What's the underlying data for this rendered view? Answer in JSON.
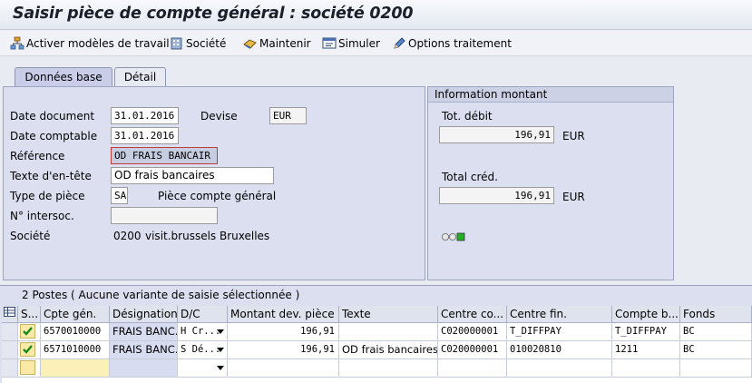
{
  "window": {
    "title": "Saisir pièce de compte général : société 0200"
  },
  "toolbar": {
    "activate_label": "Activer modèles de travail",
    "company_label": "Société",
    "hold_label": "Maintenir",
    "simulate_label": "Simuler",
    "options_label": "Options traitement"
  },
  "tabs": [
    {
      "label": "Données base"
    },
    {
      "label": "Détail"
    }
  ],
  "form": {
    "doc_date_label": "Date document",
    "doc_date": "31.01.2016",
    "currency_label": "Devise",
    "currency": "EUR",
    "post_date_label": "Date comptable",
    "post_date": "31.01.2016",
    "reference_label": "Référence",
    "reference": "OD FRAIS BANCAIR",
    "header_text_label": "Texte d'en-tête",
    "header_text": "OD frais bancaires",
    "doc_type_label": "Type de pièce",
    "doc_type": "SA",
    "doc_type_desc": "Pièce compte général",
    "intercomp_label": "N° intersoc.",
    "intercomp": "",
    "company_label": "Société",
    "company": "0200",
    "company_name": "visit.brussels Bruxelles"
  },
  "amount_info": {
    "header": "Information montant",
    "total_debit_label": "Tot. débit",
    "total_debit": "196,91",
    "total_debit_cur": "EUR",
    "total_credit_label": "Total créd.",
    "total_credit": "196,91",
    "total_credit_cur": "EUR",
    "status_light": "green"
  },
  "items": {
    "title": "2 Postes ( Aucune variante de saisie sélectionnée )",
    "columns": [
      "S...",
      "Cpte gén.",
      "Désignation",
      "D/C",
      "Montant dev. pièce",
      "Texte",
      "Centre co...",
      "Centre fin.",
      "Compte b...",
      "Fonds"
    ],
    "rows": [
      {
        "status": "ok",
        "account": "6570010000",
        "designation": "FRAIS BANC...",
        "dc": "H Cr...",
        "amount": "196,91",
        "text": "",
        "cost_center": "C020000001",
        "fund_center": "T_DIFFPAY",
        "budget_account": "T_DIFFPAY",
        "fund": "BC"
      },
      {
        "status": "ok",
        "account": "6571010000",
        "designation": "FRAIS BANC...",
        "dc": "S Dé...",
        "amount": "196,91",
        "text": "OD frais bancaires",
        "cost_center": "C020000001",
        "fund_center": "010020810",
        "budget_account": "1211",
        "fund": "BC"
      }
    ]
  },
  "colors": {
    "accent_panel": "#dcdff0",
    "status_green": "#22b022"
  }
}
